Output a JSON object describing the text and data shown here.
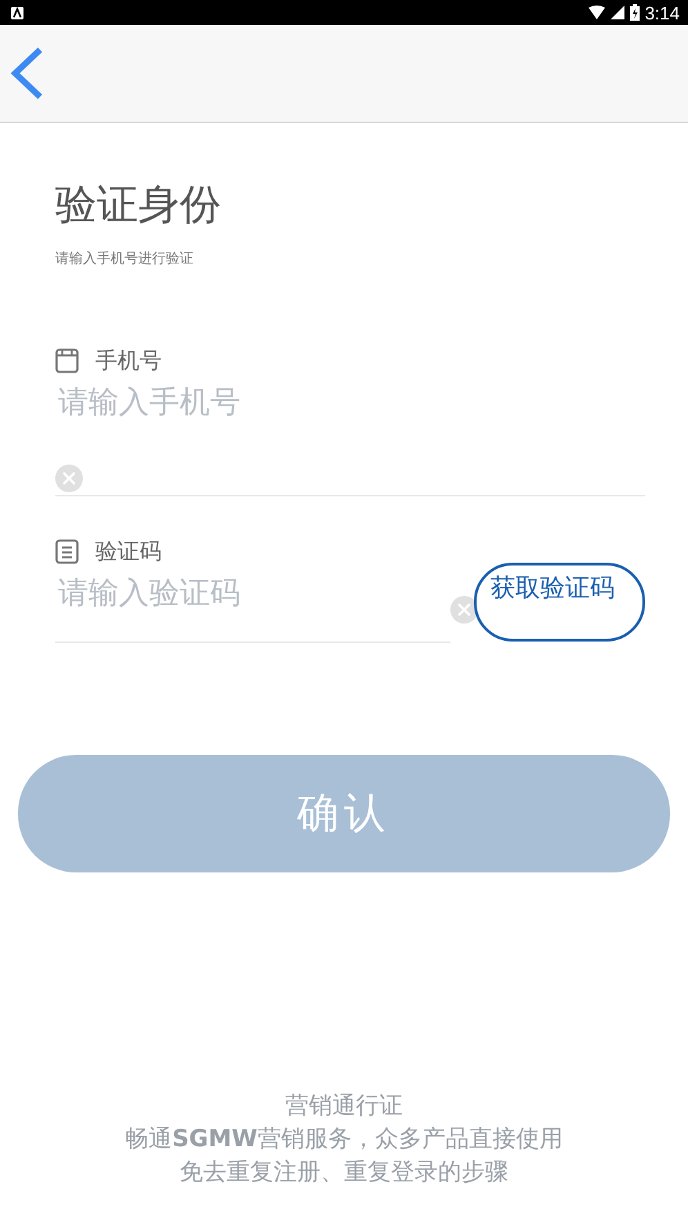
{
  "status_bar": {
    "time": "3:14"
  },
  "title": "验证身份",
  "subtitle": "请输入手机号进行验证",
  "fields": [
    {
      "kind": "phone",
      "label": "手机号",
      "placeholder": "请输入手机号"
    },
    {
      "kind": "code",
      "label": "验证码",
      "placeholder": "请输入验证码",
      "action": "获取验证码"
    }
  ],
  "confirm_button": {
    "label": "确认",
    "disabled": true
  },
  "footer": [
    "营销通行证",
    "畅通**SGMW**营销服务，众多产品直接使用",
    "免去重复注册、重复登录的步骤"
  ]
}
